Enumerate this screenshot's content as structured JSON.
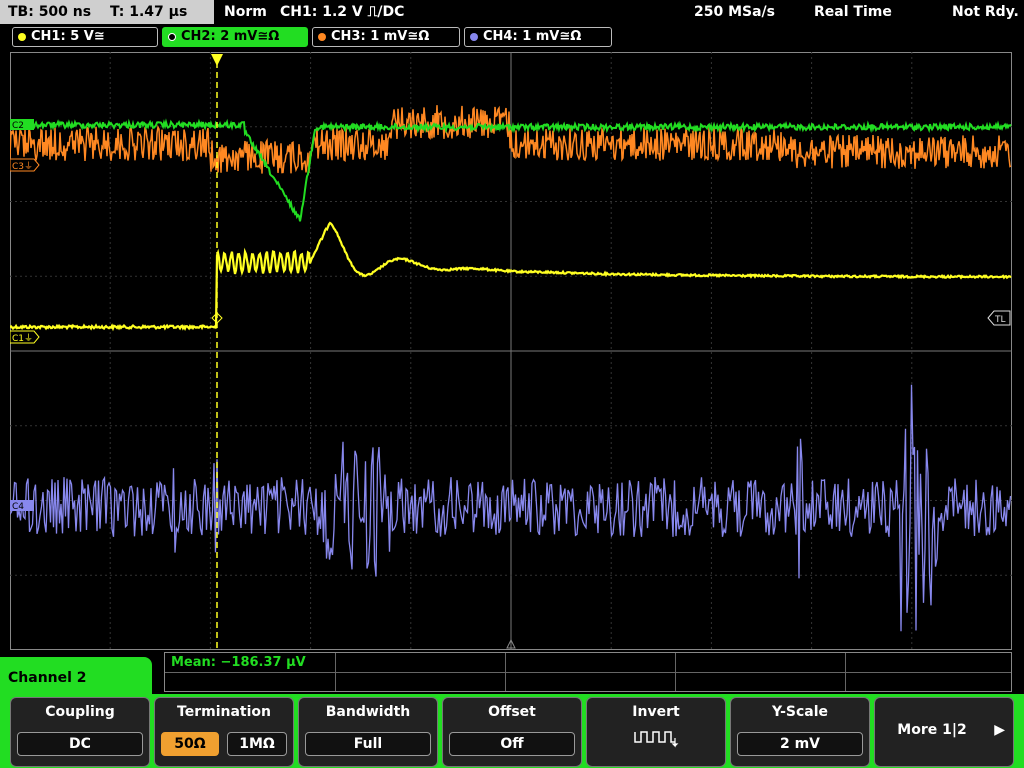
{
  "status": {
    "timebase": "TB: 500 ns",
    "trigger_time": "T: 1.47 µs",
    "trigger_mode": "Norm",
    "trigger_source": "CH1: 1.2 V ⎍/DC",
    "sample_rate": "250 MSa/s",
    "acq_mode": "Real Time",
    "ready": "Not Rdy."
  },
  "channels": [
    {
      "label": "CH1: 5 V≅",
      "color": "#ffff22",
      "active": false
    },
    {
      "label": "CH2: 2 mV≅Ω",
      "color": "#22dd22",
      "active": true
    },
    {
      "label": "CH3: 1 mV≅Ω",
      "color": "#ff8822",
      "active": false
    },
    {
      "label": "CH4: 1 mV≅Ω",
      "color": "#8888ee",
      "active": false
    }
  ],
  "markers": {
    "c1": "C1⏚",
    "c3": "C3⏚",
    "c4": "C4",
    "c2": "C2",
    "trigger_level": "TL"
  },
  "measurement": {
    "label": "Mean: −186.37 µV"
  },
  "menu": {
    "title": "Channel 2",
    "coupling": {
      "title": "Coupling",
      "value": "DC"
    },
    "termination": {
      "title": "Termination",
      "opt1": "50Ω",
      "opt2": "1MΩ"
    },
    "bandwidth": {
      "title": "Bandwidth",
      "value": "Full"
    },
    "offset": {
      "title": "Offset",
      "value": "Off"
    },
    "invert": {
      "title": "Invert",
      "icon": "invert-waveform-icon"
    },
    "yscale": {
      "title": "Y-Scale",
      "value": "2 mV"
    },
    "more": {
      "label": "More 1|2",
      "icon": "right-arrow-icon"
    }
  },
  "colors": {
    "ch1": "#ffff22",
    "ch2": "#22dd22",
    "ch3": "#ff8822",
    "ch4": "#8888ee",
    "menu": "#22dd22",
    "selected": "#f0a030"
  }
}
